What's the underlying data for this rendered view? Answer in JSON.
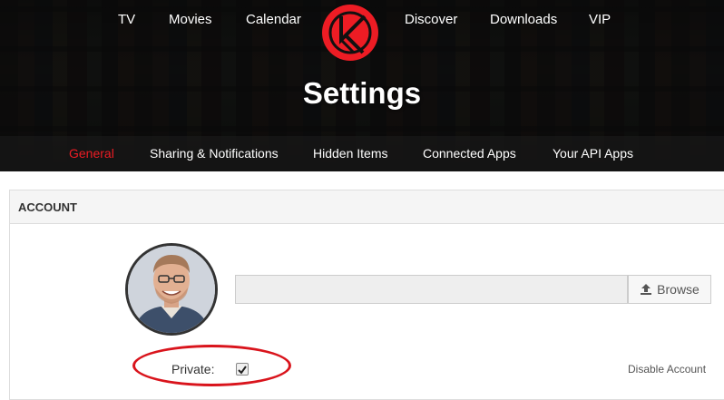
{
  "colors": {
    "accent": "#ed1c24",
    "annotation_red": "#d9141c",
    "header_bg": "#1b1b1b"
  },
  "topnav": {
    "items": [
      {
        "label": "TV"
      },
      {
        "label": "Movies"
      },
      {
        "label": "Calendar"
      },
      {
        "label": "Discover"
      },
      {
        "label": "Downloads"
      },
      {
        "label": "VIP"
      }
    ],
    "logo_icon": "trakt-logo-icon"
  },
  "page": {
    "title": "Settings"
  },
  "tabs": {
    "items": [
      {
        "label": "General",
        "active": true
      },
      {
        "label": "Sharing & Notifications",
        "active": false
      },
      {
        "label": "Hidden Items",
        "active": false
      },
      {
        "label": "Connected Apps",
        "active": false
      },
      {
        "label": "Your API Apps",
        "active": false
      }
    ]
  },
  "account": {
    "section_title": "ACCOUNT",
    "avatar_icon": "user-avatar",
    "file_input_value": "",
    "browse_label": "Browse",
    "browse_icon": "upload-icon",
    "private_label": "Private:",
    "private_checked": true,
    "disable_label": "Disable Account"
  }
}
